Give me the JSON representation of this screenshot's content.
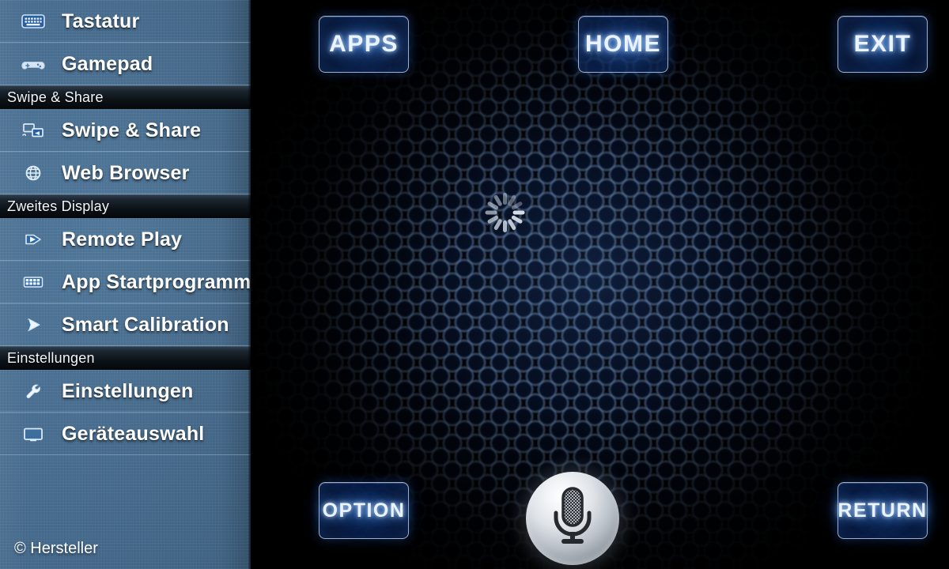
{
  "sidebar": {
    "rows": [
      {
        "label": "Tastatur",
        "icon": "keyboard-icon",
        "type": "item"
      },
      {
        "label": "Gamepad",
        "icon": "gamepad-icon",
        "type": "item"
      },
      {
        "label": "Swipe & Share",
        "icon": null,
        "type": "header"
      },
      {
        "label": "Swipe & Share",
        "icon": "swipe-share-icon",
        "type": "item"
      },
      {
        "label": "Web Browser",
        "icon": "globe-icon",
        "type": "item"
      },
      {
        "label": "Zweites Display",
        "icon": null,
        "type": "header"
      },
      {
        "label": "Remote Play",
        "icon": "play-icon",
        "type": "item"
      },
      {
        "label": "App Startprogramm",
        "icon": "grid-icon",
        "type": "item"
      },
      {
        "label": "Smart Calibration",
        "icon": "calibration-icon",
        "type": "item"
      },
      {
        "label": "Einstellungen",
        "icon": null,
        "type": "header"
      },
      {
        "label": "Einstellungen",
        "icon": "wrench-icon",
        "type": "item"
      },
      {
        "label": "Geräteauswahl",
        "icon": "monitor-icon",
        "type": "item"
      }
    ],
    "copyright": "© Hersteller",
    "background_color": "#48709 3",
    "text_color": "#ffffff"
  },
  "main": {
    "buttons": {
      "apps": "APPS",
      "home": "HOME",
      "exit": "EXIT",
      "option": "OPTION",
      "return": "RETURN"
    },
    "mic": {
      "icon": "microphone-icon",
      "label": "Voice input"
    },
    "spinner": {
      "icon": "loading-spinner-icon",
      "blades": 12
    },
    "background": {
      "pattern": "hexagonal-mesh",
      "accent_color": "#3a6ab4",
      "base_color": "#000000"
    },
    "glow_color": "#6eafff"
  }
}
